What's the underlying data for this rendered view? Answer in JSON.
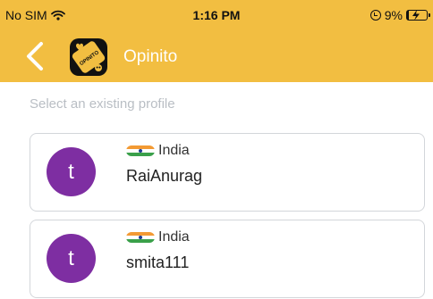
{
  "status_bar": {
    "carrier": "No SIM",
    "time": "1:16 PM",
    "battery": "9%",
    "wifi_icon": "wifi-icon",
    "battery_icon": "battery-charging-icon",
    "orientation_icon": "orientation-lock-icon"
  },
  "nav": {
    "title": "Opinito",
    "back_icon": "chevron-left-icon",
    "logo_text": "OPINITO",
    "color": "#F2BE41"
  },
  "section_label": "Select an existing profile",
  "profiles": [
    {
      "avatar_letter": "t",
      "country": "India",
      "username": "RaiAnurag"
    },
    {
      "avatar_letter": "t",
      "country": "India",
      "username": "smita111"
    }
  ],
  "colors": {
    "avatar": "#7E2EA2",
    "header": "#F2BE41"
  }
}
